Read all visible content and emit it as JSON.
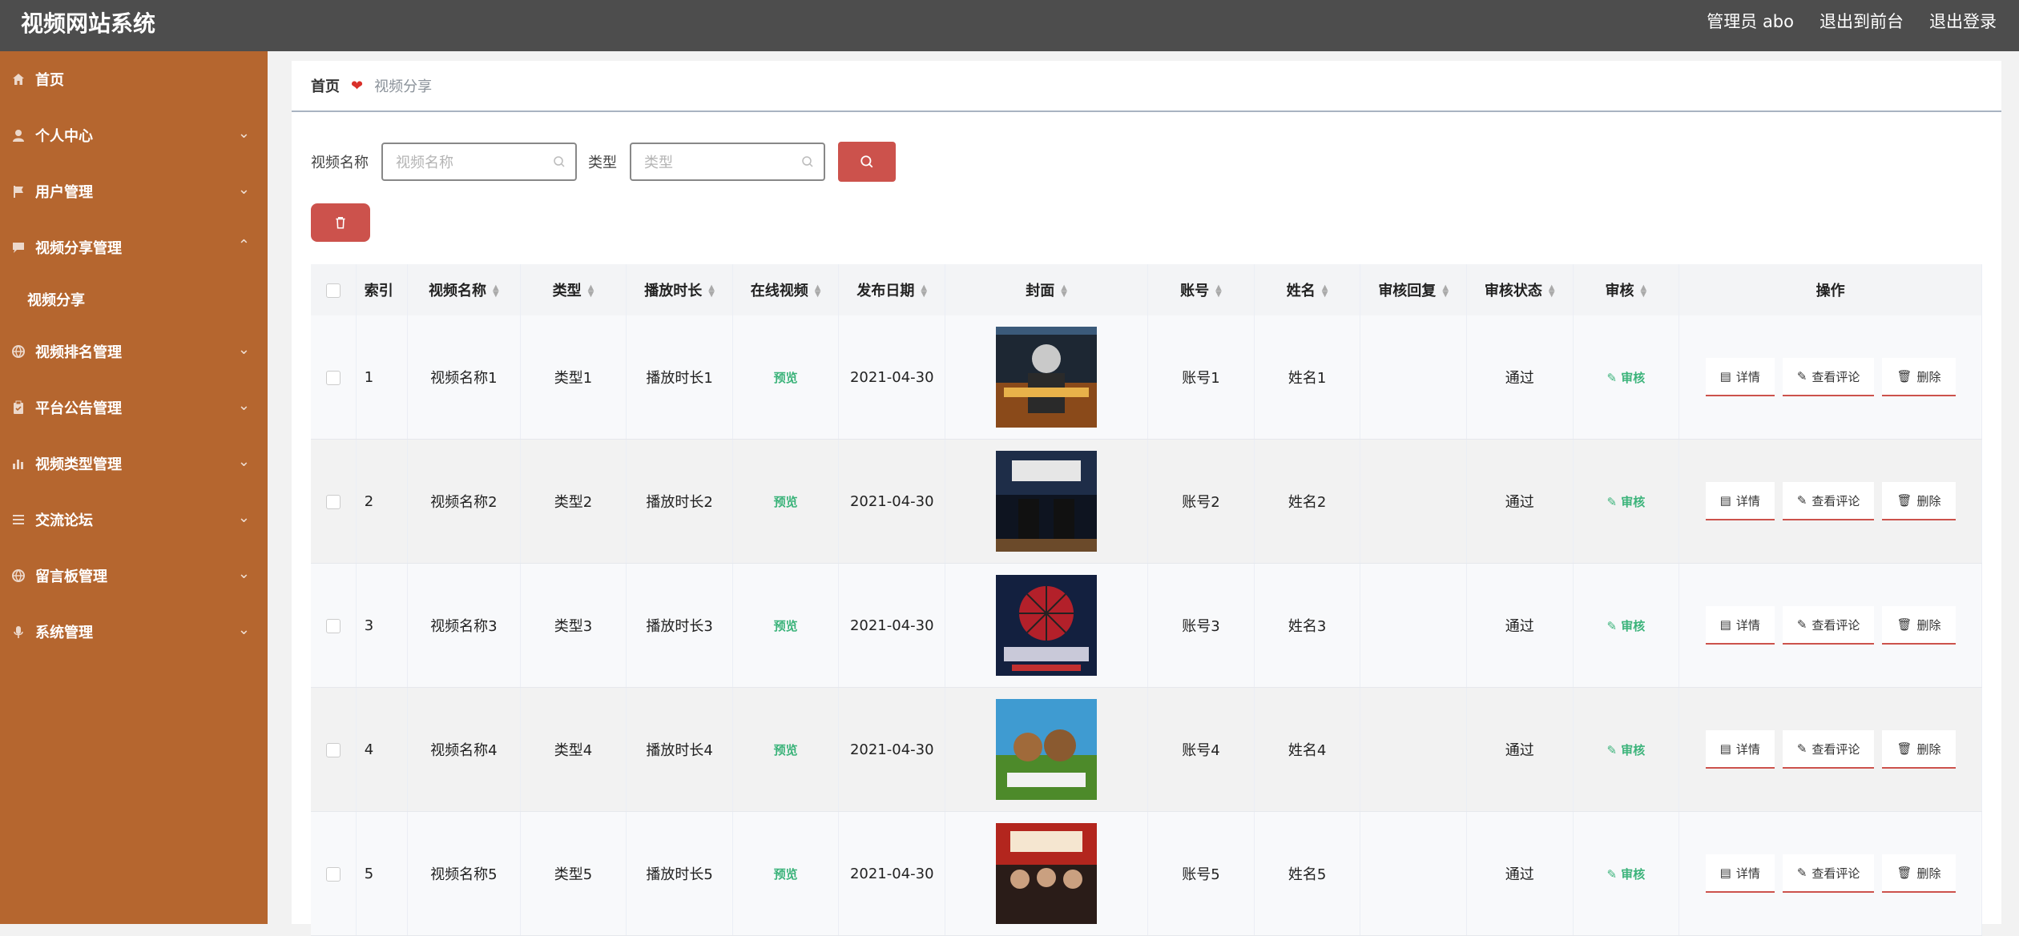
{
  "app": {
    "title": "视频网站系统"
  },
  "topbar": {
    "admin_label": "管理员 abo",
    "front_label": "退出到前台",
    "logout_label": "退出登录"
  },
  "sidebar": {
    "items": [
      {
        "label": "首页",
        "icon": "home-icon",
        "expandable": false
      },
      {
        "label": "个人中心",
        "icon": "user-icon",
        "expandable": true,
        "expanded": false
      },
      {
        "label": "用户管理",
        "icon": "flag-icon",
        "expandable": true,
        "expanded": false
      },
      {
        "label": "视频分享管理",
        "icon": "chat-icon",
        "expandable": true,
        "expanded": true
      },
      {
        "label": "视频排名管理",
        "icon": "globe-icon",
        "expandable": true,
        "expanded": false
      },
      {
        "label": "平台公告管理",
        "icon": "clipboard-icon",
        "expandable": true,
        "expanded": false
      },
      {
        "label": "视频类型管理",
        "icon": "chart-icon",
        "expandable": true,
        "expanded": false
      },
      {
        "label": "交流论坛",
        "icon": "list-icon",
        "expandable": true,
        "expanded": false
      },
      {
        "label": "留言板管理",
        "icon": "globe-icon",
        "expandable": true,
        "expanded": false
      },
      {
        "label": "系统管理",
        "icon": "mic-icon",
        "expandable": true,
        "expanded": false
      }
    ],
    "sub_items": {
      "video_share": "视频分享"
    }
  },
  "breadcrumb": {
    "home": "首页",
    "current": "视频分享"
  },
  "search": {
    "name_label": "视频名称",
    "name_placeholder": "视频名称",
    "name_value": "",
    "type_label": "类型",
    "type_placeholder": "类型",
    "type_value": ""
  },
  "table": {
    "headers": {
      "index": "索引",
      "name": "视频名称",
      "type": "类型",
      "duration": "播放时长",
      "online": "在线视频",
      "date": "发布日期",
      "cover": "封面",
      "account": "账号",
      "username": "姓名",
      "reply": "审核回复",
      "status": "审核状态",
      "audit": "审核",
      "ops": "操作"
    },
    "preview_label": "预览",
    "audit_label": "审核",
    "ops": {
      "detail": "详情",
      "comments": "查看评论",
      "delete": "删除"
    },
    "rows": [
      {
        "index": "1",
        "name": "视频名称1",
        "type": "类型1",
        "duration": "播放时长1",
        "date": "2021-04-30",
        "account": "账号1",
        "username": "姓名1",
        "reply": "",
        "status": "通过"
      },
      {
        "index": "2",
        "name": "视频名称2",
        "type": "类型2",
        "duration": "播放时长2",
        "date": "2021-04-30",
        "account": "账号2",
        "username": "姓名2",
        "reply": "",
        "status": "通过"
      },
      {
        "index": "3",
        "name": "视频名称3",
        "type": "类型3",
        "duration": "播放时长3",
        "date": "2021-04-30",
        "account": "账号3",
        "username": "姓名3",
        "reply": "",
        "status": "通过"
      },
      {
        "index": "4",
        "name": "视频名称4",
        "type": "类型4",
        "duration": "播放时长4",
        "date": "2021-04-30",
        "account": "账号4",
        "username": "姓名4",
        "reply": "",
        "status": "通过"
      },
      {
        "index": "5",
        "name": "视频名称5",
        "type": "类型5",
        "duration": "播放时长5",
        "date": "2021-04-30",
        "account": "账号5",
        "username": "姓名5",
        "reply": "",
        "status": "通过"
      }
    ]
  },
  "colors": {
    "topbar": "#4d4d4d",
    "sidebar": "#b5662f",
    "accent": "#cc524c",
    "link": "#3bb37a"
  }
}
